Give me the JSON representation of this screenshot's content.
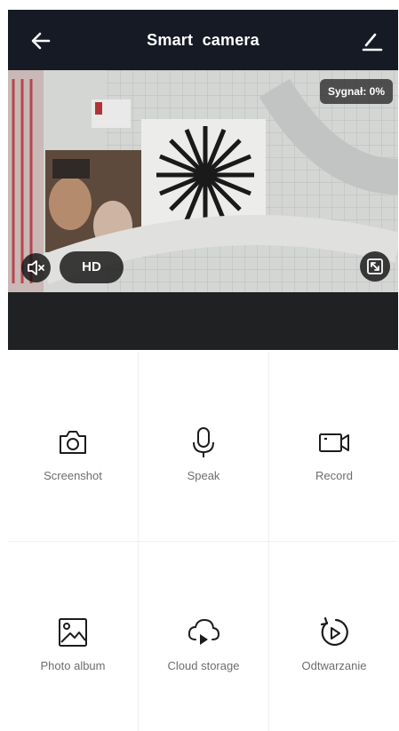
{
  "header": {
    "title": "Smart  camera",
    "back_icon": "arrow-left-icon",
    "edit_icon": "edit-icon"
  },
  "video": {
    "signal_label": "Sygnał: 0%",
    "quality_label": "HD",
    "mute_icon": "speaker-muted-icon",
    "fullscreen_icon": "fullscreen-icon"
  },
  "actions": [
    {
      "label": "Screenshot",
      "icon": "camera-icon"
    },
    {
      "label": "Speak",
      "icon": "microphone-icon"
    },
    {
      "label": "Record",
      "icon": "video-camera-icon"
    },
    {
      "label": "Photo album",
      "icon": "image-icon"
    },
    {
      "label": "Cloud storage",
      "icon": "cloud-play-icon"
    },
    {
      "label": "Odtwarzanie",
      "icon": "replay-icon"
    }
  ]
}
